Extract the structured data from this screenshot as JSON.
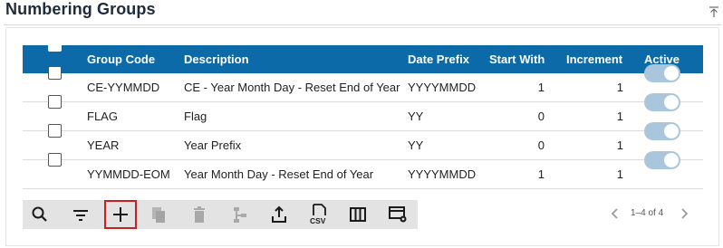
{
  "header": {
    "title": "Numbering Groups"
  },
  "table": {
    "columns": {
      "code": "Group Code",
      "description": "Description",
      "prefix": "Date Prefix",
      "start": "Start With",
      "increment": "Increment",
      "active": "Active"
    },
    "rows": [
      {
        "code": "CE-YYMMDD",
        "description": "CE - Year Month Day - Reset End of Year",
        "prefix": "YYYYMMDD",
        "start": "1",
        "increment": "1",
        "active": true
      },
      {
        "code": "FLAG",
        "description": "Flag",
        "prefix": "YY",
        "start": "0",
        "increment": "1",
        "active": true
      },
      {
        "code": "YEAR",
        "description": "Year Prefix",
        "prefix": "YY",
        "start": "0",
        "increment": "1",
        "active": true
      },
      {
        "code": "YYMMDD-EOM",
        "description": "Year Month Day - Reset End of Year",
        "prefix": "YYYYMMDD",
        "start": "1",
        "increment": "1",
        "active": true
      }
    ]
  },
  "toolbar": {
    "buttons": [
      {
        "name": "search-icon",
        "enabled": true
      },
      {
        "name": "filter-icon",
        "enabled": true
      },
      {
        "name": "add-icon",
        "enabled": true,
        "selected": true
      },
      {
        "name": "copy-icon",
        "enabled": false
      },
      {
        "name": "delete-icon",
        "enabled": false
      },
      {
        "name": "hierarchy-icon",
        "enabled": false
      },
      {
        "name": "export-icon",
        "enabled": true
      },
      {
        "name": "csv-icon",
        "enabled": true,
        "label": "CSV"
      },
      {
        "name": "columns-icon",
        "enabled": true
      },
      {
        "name": "table-settings-icon",
        "enabled": true
      }
    ]
  },
  "pager": {
    "text": "1–4 of 4"
  },
  "colors": {
    "header_bg": "#0c6aa8",
    "toggle_on": "#a9c6dd",
    "selected_outline": "#c81f1f"
  }
}
